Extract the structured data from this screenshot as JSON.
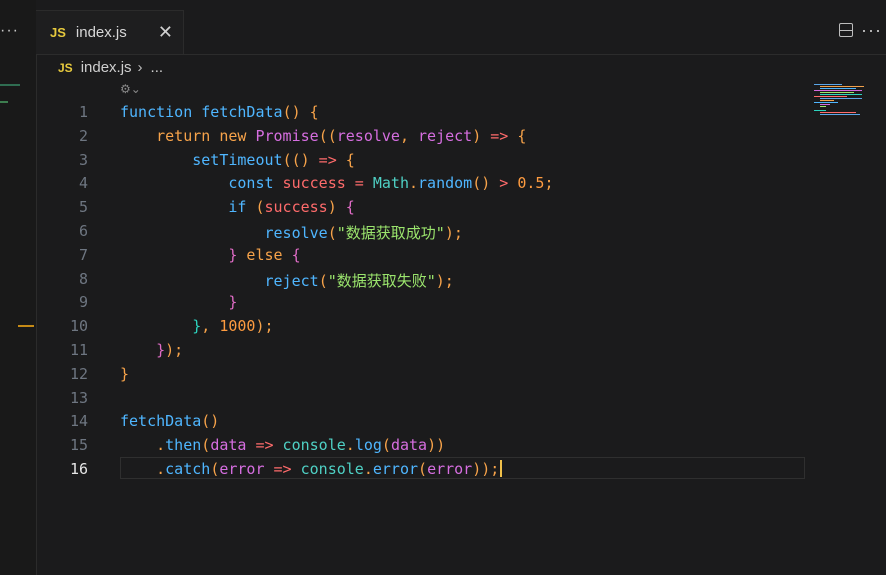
{
  "tab": {
    "badge": "JS",
    "title": "index.js",
    "close": "✕"
  },
  "breadcrumb": {
    "badge": "JS",
    "file": "index.js",
    "sep": "›",
    "ellipsis": "..."
  },
  "left_dots": "···",
  "right_dots": "···",
  "editor": {
    "active_line": 16,
    "lines": [
      {
        "num": "1",
        "tokens": [
          [
            "kw",
            "function"
          ],
          [
            "",
            ""
          ],
          [
            "fn",
            " fetchData"
          ],
          [
            "punc",
            "()"
          ],
          [
            "",
            ""
          ],
          [
            "punc",
            " {"
          ]
        ]
      },
      {
        "num": "2",
        "tokens": [
          [
            "",
            ""
          ],
          [
            "kw2",
            "    return"
          ],
          [
            "kw2",
            " new"
          ],
          [
            "promise",
            " Promise"
          ],
          [
            "punc",
            "(("
          ],
          [
            "param",
            "resolve"
          ],
          [
            "punc",
            ","
          ],
          [
            "param",
            " reject"
          ],
          [
            "punc",
            ")"
          ],
          [
            "op",
            " =>"
          ],
          [
            "punc",
            " {"
          ]
        ]
      },
      {
        "num": "3",
        "tokens": [
          [
            "fn",
            "        setTimeout"
          ],
          [
            "punc",
            "(("
          ],
          [
            "punc",
            ")"
          ],
          [
            "op",
            " =>"
          ],
          [
            "punc",
            " {"
          ]
        ]
      },
      {
        "num": "4",
        "tokens": [
          [
            "kw",
            "            const"
          ],
          [
            "var",
            " success"
          ],
          [
            "op",
            " ="
          ],
          [
            "obj",
            " Math"
          ],
          [
            "",
            ""
          ],
          [
            "punc",
            "."
          ],
          [
            "fn",
            "random"
          ],
          [
            "punc",
            "()"
          ],
          [
            "op",
            " >"
          ],
          [
            "num",
            " 0.5"
          ],
          [
            "punc",
            ";"
          ]
        ]
      },
      {
        "num": "5",
        "tokens": [
          [
            "kw",
            "            if"
          ],
          [
            "punc",
            " ("
          ],
          [
            "var",
            "success"
          ],
          [
            "punc",
            ")"
          ],
          [
            "pink",
            " {"
          ]
        ]
      },
      {
        "num": "6",
        "tokens": [
          [
            "fn",
            "                resolve"
          ],
          [
            "punc",
            "("
          ],
          [
            "str",
            "\"数据获取成功\""
          ],
          [
            "punc",
            ");"
          ]
        ]
      },
      {
        "num": "7",
        "tokens": [
          [
            "pink",
            "            }"
          ],
          [
            "kw2",
            " else"
          ],
          [
            "pink",
            " {"
          ]
        ]
      },
      {
        "num": "8",
        "tokens": [
          [
            "fn",
            "                reject"
          ],
          [
            "punc",
            "("
          ],
          [
            "str",
            "\"数据获取失败\""
          ],
          [
            "punc",
            ");"
          ]
        ]
      },
      {
        "num": "9",
        "tokens": [
          [
            "pink",
            "            }"
          ]
        ]
      },
      {
        "num": "10",
        "tokens": [
          [
            "cyan",
            "        }"
          ],
          [
            "punc",
            ","
          ],
          [
            "num",
            " 1000"
          ],
          [
            "punc",
            ");"
          ]
        ]
      },
      {
        "num": "11",
        "tokens": [
          [
            "pink",
            "    }"
          ],
          [
            "punc",
            ");"
          ]
        ]
      },
      {
        "num": "12",
        "tokens": [
          [
            "punc",
            "}"
          ]
        ]
      },
      {
        "num": "13",
        "tokens": []
      },
      {
        "num": "14",
        "tokens": [
          [
            "fn",
            "fetchData"
          ],
          [
            "punc",
            "()"
          ]
        ]
      },
      {
        "num": "15",
        "tokens": [
          [
            "",
            ""
          ],
          [
            "punc",
            "    ."
          ],
          [
            "fn",
            "then"
          ],
          [
            "punc",
            "("
          ],
          [
            "param",
            "data"
          ],
          [
            "op",
            " =>"
          ],
          [
            "obj",
            " console"
          ],
          [
            "punc",
            "."
          ],
          [
            "fn",
            "log"
          ],
          [
            "punc",
            "("
          ],
          [
            "param",
            "data"
          ],
          [
            "punc",
            "))"
          ]
        ]
      },
      {
        "num": "16",
        "tokens": [
          [
            "punc",
            "    ."
          ],
          [
            "fn",
            "catch"
          ],
          [
            "punc",
            "("
          ],
          [
            "param",
            "error"
          ],
          [
            "op",
            " =>"
          ],
          [
            "obj",
            " console"
          ],
          [
            "punc",
            "."
          ],
          [
            "fn",
            "error"
          ],
          [
            "punc",
            "("
          ],
          [
            "param",
            "error"
          ],
          [
            "punc",
            "));"
          ]
        ]
      }
    ]
  }
}
